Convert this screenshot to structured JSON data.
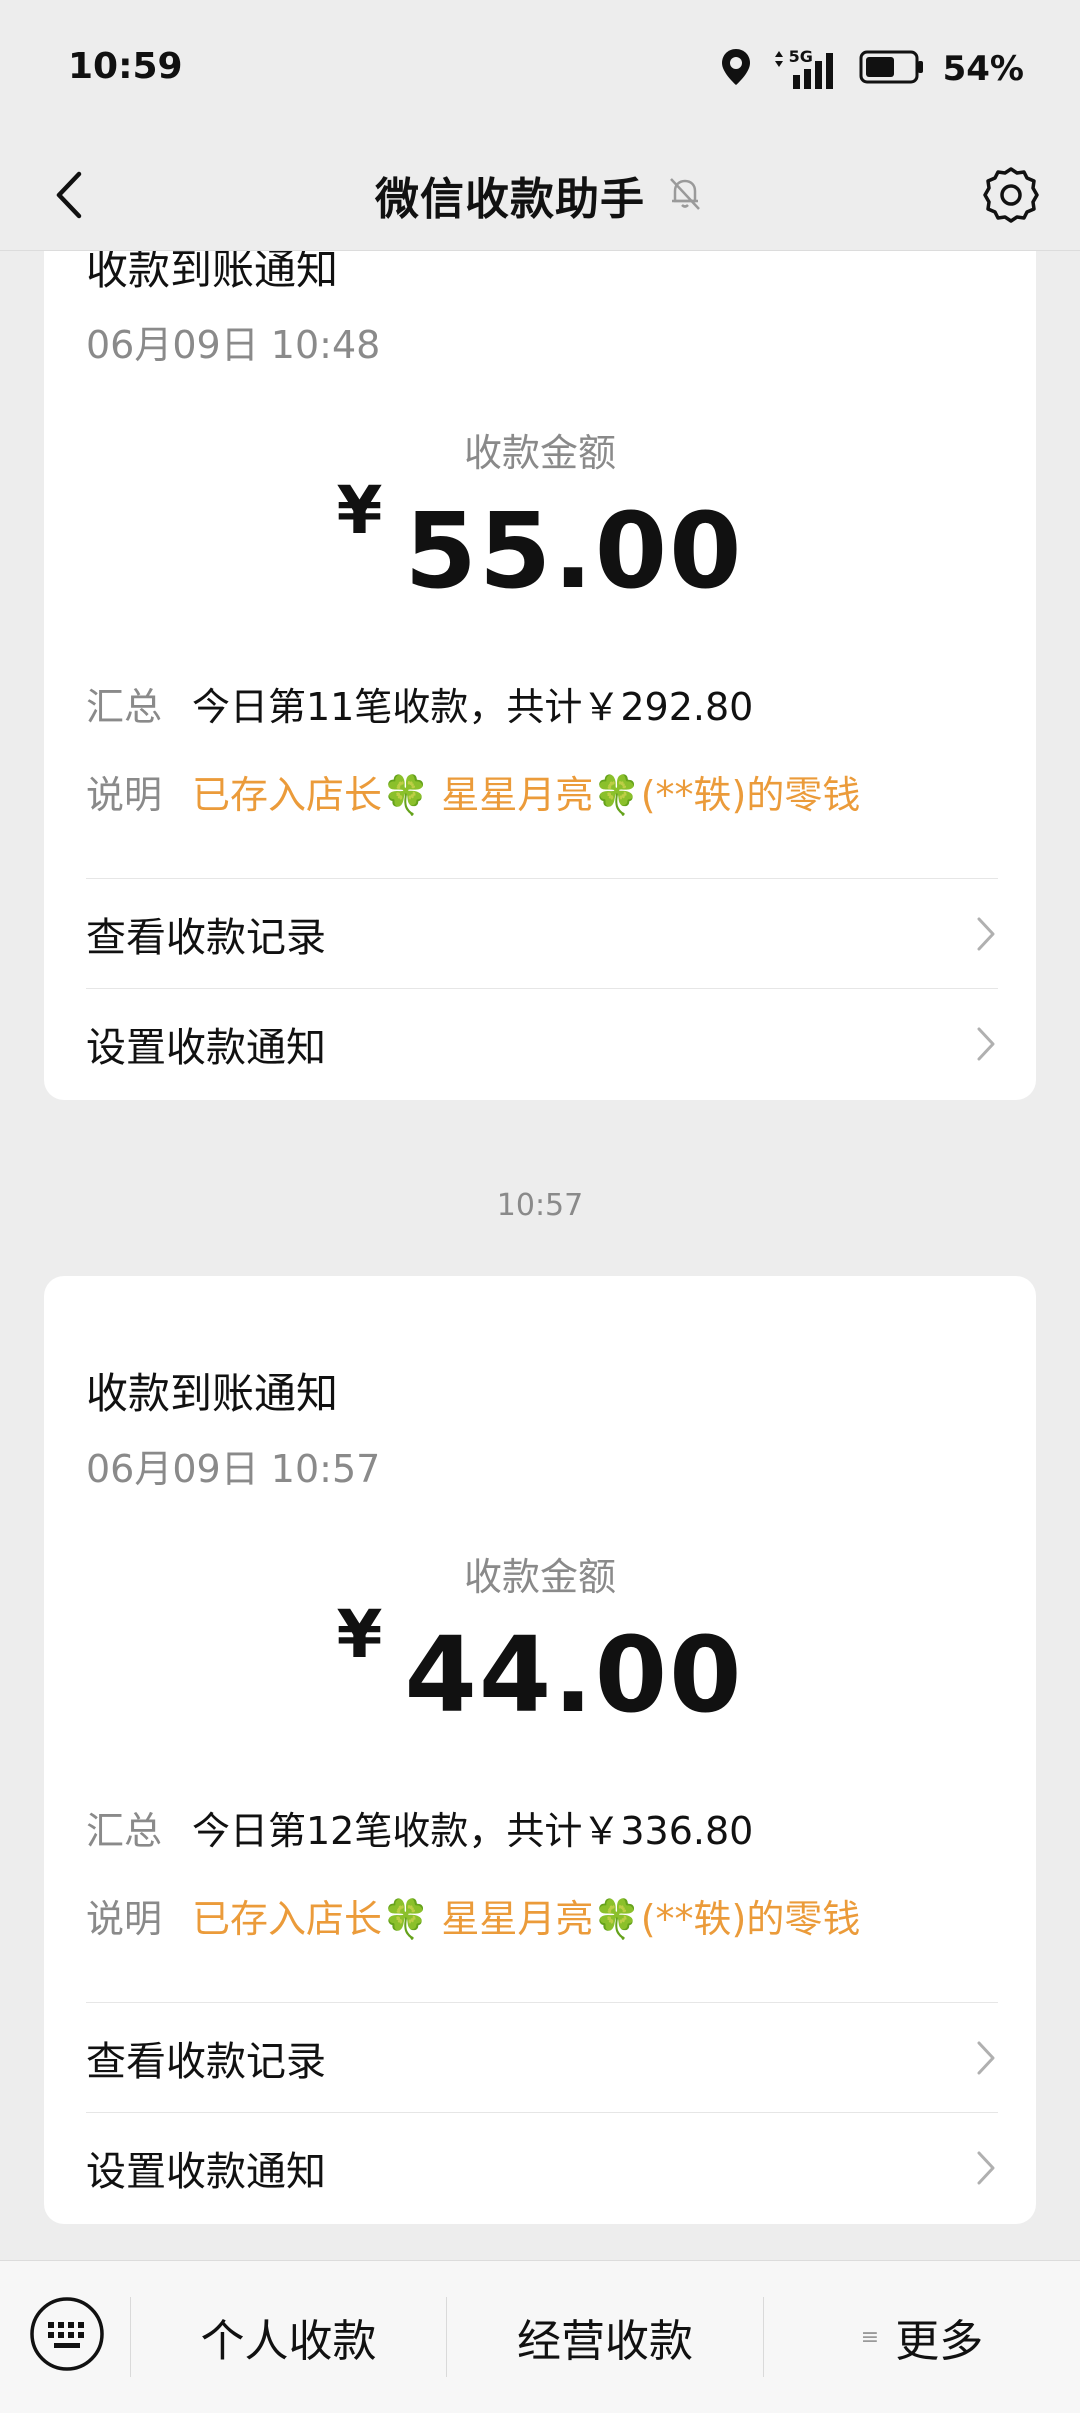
{
  "status": {
    "time": "10:59",
    "network": "5G",
    "battery": "54%",
    "battery_level": 0.54
  },
  "header": {
    "title": "微信收款助手",
    "icons": [
      "back-chevron-icon",
      "muted-bell-icon",
      "gear-icon"
    ]
  },
  "cards": [
    {
      "title": "收款到账通知",
      "date": "06月09日 10:48",
      "amount_label": "收款金额",
      "currency": "¥",
      "amount": "55.00",
      "summary_key": "汇总",
      "summary_value": "今日第11笔收款，共计￥292.80",
      "note_key": "说明",
      "note_value": "已存入店长🍀 星星月亮🍀(**轶)的零钱",
      "link_records": "查看收款记录",
      "link_settings": "设置收款通知"
    },
    {
      "title": "收款到账通知",
      "date": "06月09日 10:57",
      "amount_label": "收款金额",
      "currency": "¥",
      "amount": "44.00",
      "summary_key": "汇总",
      "summary_value": "今日第12笔收款，共计￥336.80",
      "note_key": "说明",
      "note_value": "已存入店长🍀 星星月亮🍀(**轶)的零钱",
      "link_records": "查看收款记录",
      "link_settings": "设置收款通知"
    }
  ],
  "time_separator": "10:57",
  "bottom": {
    "tab1": "个人收款",
    "tab2": "经营收款",
    "tab3": "更多"
  },
  "colors": {
    "accent_orange": "#eb9b3a",
    "background": "#ededed",
    "card": "#ffffff"
  }
}
